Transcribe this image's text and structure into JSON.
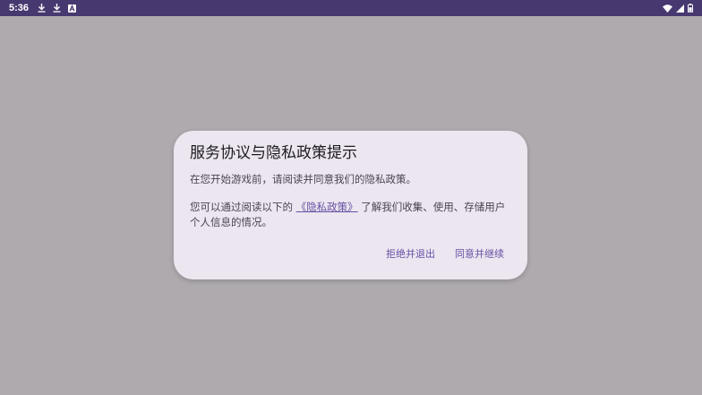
{
  "status_bar": {
    "time": "5:36",
    "icons": [
      "download-icon",
      "download-icon",
      "app-notification-icon",
      "wifi-icon",
      "signal-icon",
      "battery-icon"
    ],
    "background": "#47386f"
  },
  "dialog": {
    "title": "服务协议与隐私政策提示",
    "paragraph1": "在您开始游戏前，请阅读并同意我们的隐私政策。",
    "paragraph2_prefix": "您可以通过阅读以下的 ",
    "privacy_link": "《隐私政策》",
    "paragraph2_suffix": " 了解我们收集、使用、存储用户个人信息的情况。",
    "decline_button": "拒绝并退出",
    "accept_button": "同意并继续",
    "accent_color": "#6750a4",
    "background": "#ece6f0"
  }
}
